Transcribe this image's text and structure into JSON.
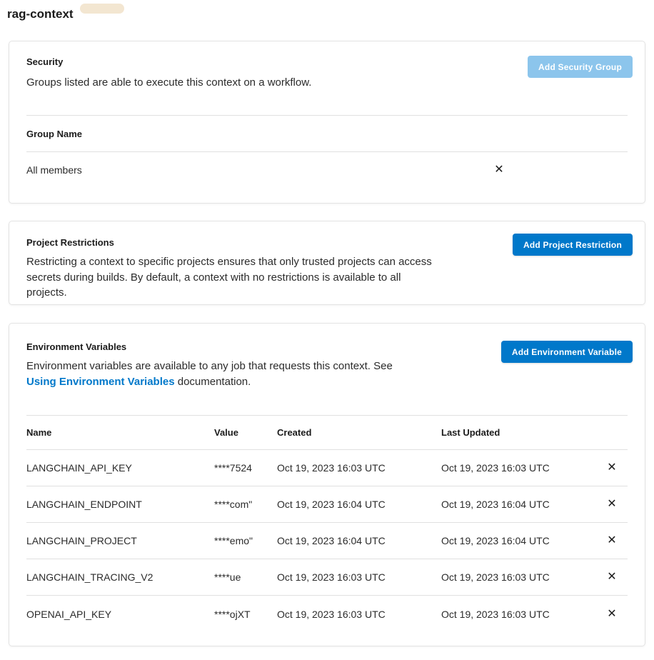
{
  "page": {
    "title": "rag-context"
  },
  "icons": {
    "remove": "✕"
  },
  "colors": {
    "primary_button": "#0078ca",
    "disabled_button": "#8cc5ec",
    "link": "#0078ca",
    "text": "#212121",
    "border": "#e3e3e3",
    "divider": "#e0e0e0"
  },
  "security": {
    "heading": "Security",
    "description": "Groups listed are able to execute this context on a workflow.",
    "add_button": "Add Security Group",
    "table": {
      "header": "Group Name",
      "rows": [
        {
          "name": "All members"
        }
      ]
    }
  },
  "project_restrictions": {
    "heading": "Project Restrictions",
    "description": "Restricting a context to specific projects ensures that only trusted projects can access secrets during builds. By default, a context with no restrictions is available to all projects.",
    "add_button": "Add Project Restriction"
  },
  "environment_variables": {
    "heading": "Environment Variables",
    "description_prefix": "Environment variables are available to any job that requests this context. See ",
    "link_text": "Using Environment Variables",
    "description_suffix": " documentation.",
    "add_button": "Add Environment Variable",
    "table": {
      "columns": [
        "Name",
        "Value",
        "Created",
        "Last Updated"
      ],
      "rows": [
        {
          "name": "LANGCHAIN_API_KEY",
          "value": "****7524",
          "created": "Oct 19, 2023 16:03 UTC",
          "last_updated": "Oct 19, 2023 16:03 UTC"
        },
        {
          "name": "LANGCHAIN_ENDPOINT",
          "value": "****com\"",
          "created": "Oct 19, 2023 16:04 UTC",
          "last_updated": "Oct 19, 2023 16:04 UTC"
        },
        {
          "name": "LANGCHAIN_PROJECT",
          "value": "****emo\"",
          "created": "Oct 19, 2023 16:04 UTC",
          "last_updated": "Oct 19, 2023 16:04 UTC"
        },
        {
          "name": "LANGCHAIN_TRACING_V2",
          "value": "****ue",
          "created": "Oct 19, 2023 16:03 UTC",
          "last_updated": "Oct 19, 2023 16:03 UTC"
        },
        {
          "name": "OPENAI_API_KEY",
          "value": "****ojXT",
          "created": "Oct 19, 2023 16:03 UTC",
          "last_updated": "Oct 19, 2023 16:03 UTC"
        }
      ]
    }
  }
}
